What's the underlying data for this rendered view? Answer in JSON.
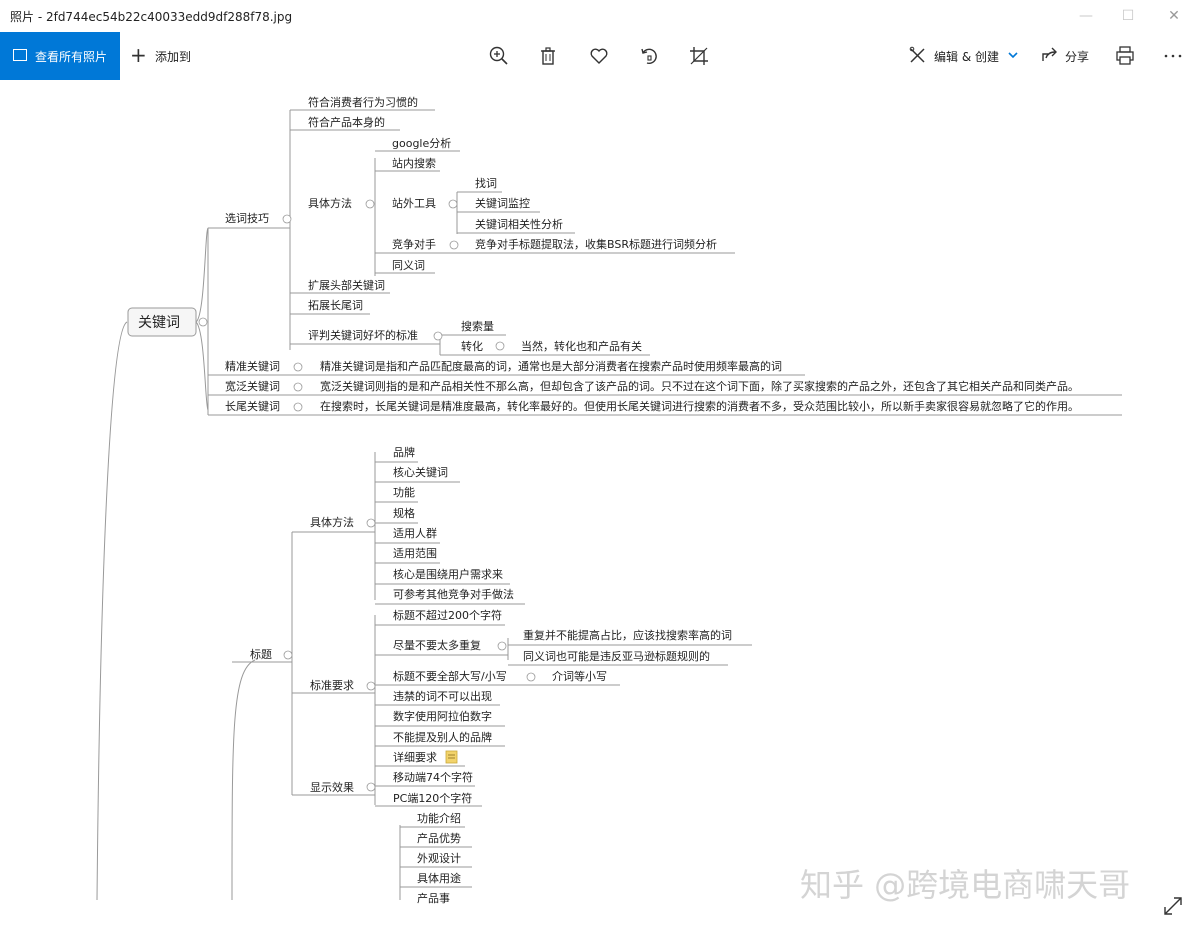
{
  "window": {
    "title": "照片 - 2fd744ec54b22c40033edd9df288f78.jpg",
    "controls": {
      "minimize": "—",
      "maximize": "☐",
      "close": "✕"
    }
  },
  "toolbar": {
    "all_photos_label": "查看所有照片",
    "add_to_label": "添加到",
    "edit_create_label": "编辑 & 创建",
    "share_label": "分享",
    "icons": [
      "zoom-in-icon",
      "delete-icon",
      "favorite-icon",
      "rotate-icon",
      "crop-icon",
      "print-icon",
      "more-icon"
    ],
    "accent": "#0078d7"
  },
  "mindmap": {
    "root": "关键词",
    "keyword_section": {
      "xuanci": "选词技巧",
      "xiguan": "符合消费者行为习惯的",
      "benshen": "符合产品本身的",
      "fangfa": "具体方法",
      "google": "google分析",
      "zhannei": "站内搜索",
      "zhanwai": "站外工具",
      "zhaoci": "找词",
      "jiankong": "关键词监控",
      "xiangguan": "关键词相关性分析",
      "jingzheng": "竞争对手",
      "jingzheng_desc": "竞争对手标题提取法，收集BSR标题进行词频分析",
      "tongyi": "同义词",
      "kuozhan": "扩展头部关键词",
      "tuozhan": "拓展长尾词",
      "pingpan": "评判关键词好坏的标准",
      "sousuo": "搜索量",
      "zhuanhua": "转化",
      "zhuanhua_desc": "当然，转化也和产品有关",
      "jingzhun": "精准关键词",
      "jingzhun_desc": "精准关键词是指和产品匹配度最高的词，通常也是大部分消费者在搜索产品时使用频率最高的词",
      "kuanfan": "宽泛关键词",
      "kuanfan_desc": "宽泛关键词则指的是和产品相关性不那么高，但却包含了该产品的词。只不过在这个词下面，除了买家搜索的产品之外，还包含了其它相关产品和同类产品。",
      "changwei": "长尾关键词",
      "changwei_desc": "在搜索时，长尾关键词是精准度最高，转化率最好的。但使用长尾关键词进行搜索的消费者不多，受众范围比较小，所以新手卖家很容易就忽略了它的作用。"
    },
    "title_section": {
      "biaoti": "标题",
      "fangfa": "具体方法",
      "methods": [
        "品牌",
        "核心关键词",
        "功能",
        "规格",
        "适用人群",
        "适用范围",
        "核心是围绕用户需求来",
        "可参考其他竞争对手做法"
      ],
      "yaoqiu": "标准要求",
      "req1": "标题不超过200个字符",
      "req2": "尽量不要太多重复",
      "req2a": "重复并不能提高占比，应该找搜索率高的词",
      "req2b": "同义词也可能是违反亚马逊标题规则的",
      "req3": "标题不要全部大写/小写",
      "req3a": "介词等小写",
      "req4": "违禁的词不可以出现",
      "req5": "数字使用阿拉伯数字",
      "req6": "不能提及别人的品牌",
      "req7": "详细要求",
      "xianshi": "显示效果",
      "disp1": "移动端74个字符",
      "disp2": "PC端120个字符",
      "more": [
        "功能介绍",
        "产品优势",
        "外观设计",
        "具体用途",
        "产品事"
      ]
    }
  },
  "watermark": "知乎 @跨境电商啸天哥"
}
